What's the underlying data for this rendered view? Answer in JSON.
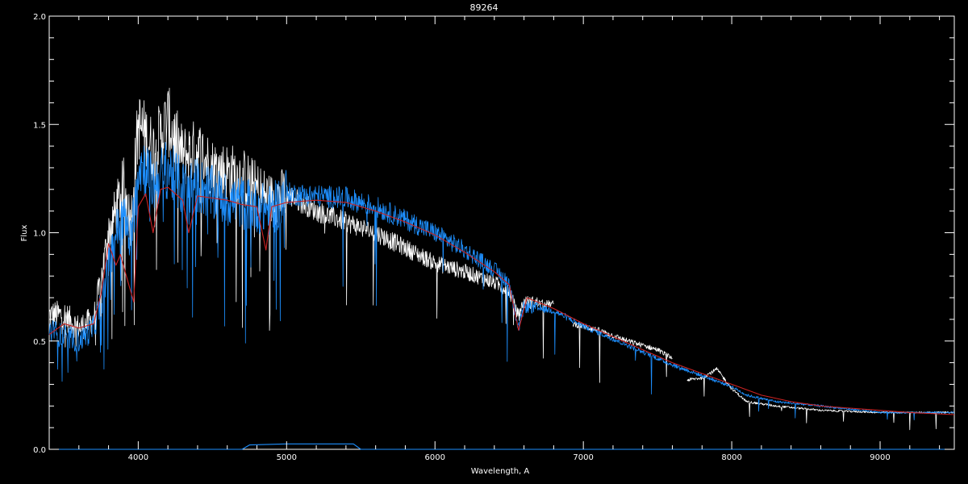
{
  "chart_data": {
    "type": "line",
    "title": "89264",
    "xlabel": "Wavelength, A",
    "ylabel": "Flux",
    "xlim": [
      3400,
      9500
    ],
    "ylim": [
      0.0,
      2.0
    ],
    "x_ticks": [
      "4000",
      "5000",
      "6000",
      "7000",
      "8000",
      "9000"
    ],
    "x_tick_values": [
      4000,
      5000,
      6000,
      7000,
      8000,
      9000
    ],
    "y_ticks": [
      "0.0",
      "0.5",
      "1.0",
      "1.5",
      "2.0"
    ],
    "y_tick_values": [
      0.0,
      0.5,
      1.0,
      1.5,
      2.0
    ],
    "background": "#000000",
    "axis_color": "#ffffff",
    "series": [
      {
        "color": "#ffffff",
        "style": "noisy",
        "points": [
          [
            3400,
            0.62
          ],
          [
            3500,
            0.62
          ],
          [
            3600,
            0.56
          ],
          [
            3700,
            0.6
          ],
          [
            3750,
            0.78
          ],
          [
            3800,
            1.0
          ],
          [
            3850,
            1.1
          ],
          [
            3900,
            1.22
          ],
          [
            3950,
            1.05
          ],
          [
            4000,
            1.5
          ],
          [
            4050,
            1.45
          ],
          [
            4100,
            1.38
          ],
          [
            4200,
            1.52
          ],
          [
            4300,
            1.35
          ],
          [
            4400,
            1.38
          ],
          [
            4500,
            1.3
          ],
          [
            4600,
            1.28
          ],
          [
            4700,
            1.26
          ],
          [
            4800,
            1.2
          ],
          [
            4900,
            1.15
          ],
          [
            5000,
            1.18
          ],
          [
            5200,
            1.1
          ],
          [
            5400,
            1.05
          ],
          [
            5600,
            1.0
          ],
          [
            5800,
            0.93
          ],
          [
            6000,
            0.86
          ],
          [
            6200,
            0.82
          ],
          [
            6400,
            0.77
          ],
          [
            6500,
            0.73
          ],
          [
            6560,
            0.62
          ],
          [
            6600,
            0.68
          ],
          [
            6800,
            0.67
          ],
          [
            null,
            null
          ],
          [
            6930,
            0.58
          ],
          [
            7100,
            0.55
          ],
          [
            7300,
            0.5
          ],
          [
            7500,
            0.46
          ],
          [
            7600,
            0.42
          ],
          [
            null,
            null
          ],
          [
            7700,
            0.32
          ],
          [
            7800,
            0.33
          ],
          [
            7900,
            0.37
          ],
          [
            8000,
            0.28
          ],
          [
            8100,
            0.22
          ],
          [
            8300,
            0.2
          ],
          [
            8600,
            0.18
          ],
          [
            9000,
            0.17
          ],
          [
            9500,
            0.17
          ]
        ]
      },
      {
        "color": "#1e90ff",
        "style": "noisy",
        "points": [
          [
            3400,
            0.55
          ],
          [
            3500,
            0.52
          ],
          [
            3600,
            0.5
          ],
          [
            3700,
            0.56
          ],
          [
            3750,
            0.68
          ],
          [
            3800,
            0.85
          ],
          [
            3850,
            1.0
          ],
          [
            3900,
            1.08
          ],
          [
            3950,
            0.95
          ],
          [
            4000,
            1.32
          ],
          [
            4050,
            1.3
          ],
          [
            4100,
            1.22
          ],
          [
            4200,
            1.3
          ],
          [
            4300,
            1.2
          ],
          [
            4400,
            1.22
          ],
          [
            4500,
            1.18
          ],
          [
            4600,
            1.15
          ],
          [
            4700,
            1.14
          ],
          [
            4800,
            1.12
          ],
          [
            4900,
            1.1
          ],
          [
            5000,
            1.18
          ],
          [
            5200,
            1.17
          ],
          [
            5400,
            1.16
          ],
          [
            5600,
            1.12
          ],
          [
            5800,
            1.06
          ],
          [
            6000,
            1.0
          ],
          [
            6200,
            0.92
          ],
          [
            6400,
            0.83
          ],
          [
            6500,
            0.77
          ],
          [
            6560,
            0.55
          ],
          [
            6600,
            0.66
          ],
          [
            6800,
            0.64
          ],
          [
            7000,
            0.57
          ],
          [
            7200,
            0.51
          ],
          [
            7400,
            0.45
          ],
          [
            7600,
            0.39
          ],
          [
            7800,
            0.34
          ],
          [
            8000,
            0.29
          ],
          [
            8100,
            0.25
          ],
          [
            8300,
            0.22
          ],
          [
            8600,
            0.2
          ],
          [
            9000,
            0.17
          ],
          [
            9500,
            0.17
          ]
        ]
      },
      {
        "color": "#cc2222",
        "style": "smooth",
        "points": [
          [
            3400,
            0.53
          ],
          [
            3500,
            0.58
          ],
          [
            3600,
            0.56
          ],
          [
            3700,
            0.58
          ],
          [
            3750,
            0.72
          ],
          [
            3800,
            0.95
          ],
          [
            3850,
            0.85
          ],
          [
            3880,
            0.9
          ],
          [
            3920,
            0.8
          ],
          [
            3970,
            0.68
          ],
          [
            4000,
            1.12
          ],
          [
            4050,
            1.18
          ],
          [
            4100,
            1.0
          ],
          [
            4150,
            1.2
          ],
          [
            4200,
            1.21
          ],
          [
            4300,
            1.15
          ],
          [
            4340,
            1.0
          ],
          [
            4400,
            1.17
          ],
          [
            4500,
            1.16
          ],
          [
            4600,
            1.15
          ],
          [
            4700,
            1.13
          ],
          [
            4800,
            1.12
          ],
          [
            4861,
            0.92
          ],
          [
            4900,
            1.12
          ],
          [
            5000,
            1.14
          ],
          [
            5200,
            1.15
          ],
          [
            5400,
            1.14
          ],
          [
            5600,
            1.1
          ],
          [
            5800,
            1.05
          ],
          [
            6000,
            0.99
          ],
          [
            6200,
            0.91
          ],
          [
            6400,
            0.82
          ],
          [
            6500,
            0.76
          ],
          [
            6563,
            0.55
          ],
          [
            6620,
            0.7
          ],
          [
            6800,
            0.65
          ],
          [
            7000,
            0.58
          ],
          [
            7200,
            0.52
          ],
          [
            7400,
            0.46
          ],
          [
            7600,
            0.4
          ],
          [
            7800,
            0.35
          ],
          [
            8000,
            0.3
          ],
          [
            8200,
            0.25
          ],
          [
            8400,
            0.22
          ],
          [
            8600,
            0.2
          ],
          [
            8800,
            0.19
          ],
          [
            9000,
            0.18
          ],
          [
            9200,
            0.17
          ],
          [
            9500,
            0.16
          ]
        ]
      },
      {
        "color": "#1e90ff",
        "style": "flat",
        "points": [
          [
            3400,
            0.0
          ],
          [
            4700,
            0.0
          ],
          [
            4750,
            0.02
          ],
          [
            5000,
            0.025
          ],
          [
            5450,
            0.025
          ],
          [
            5500,
            0.0
          ],
          [
            9500,
            0.0
          ]
        ]
      }
    ]
  }
}
